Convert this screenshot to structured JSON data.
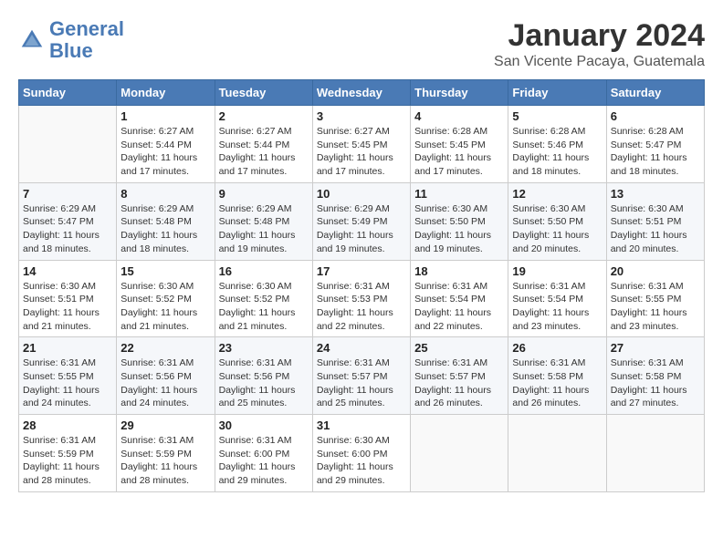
{
  "header": {
    "logo_line1": "General",
    "logo_line2": "Blue",
    "month_title": "January 2024",
    "subtitle": "San Vicente Pacaya, Guatemala"
  },
  "days_of_week": [
    "Sunday",
    "Monday",
    "Tuesday",
    "Wednesday",
    "Thursday",
    "Friday",
    "Saturday"
  ],
  "weeks": [
    [
      {
        "day": "",
        "info": ""
      },
      {
        "day": "1",
        "info": "Sunrise: 6:27 AM\nSunset: 5:44 PM\nDaylight: 11 hours and 17 minutes."
      },
      {
        "day": "2",
        "info": "Sunrise: 6:27 AM\nSunset: 5:44 PM\nDaylight: 11 hours and 17 minutes."
      },
      {
        "day": "3",
        "info": "Sunrise: 6:27 AM\nSunset: 5:45 PM\nDaylight: 11 hours and 17 minutes."
      },
      {
        "day": "4",
        "info": "Sunrise: 6:28 AM\nSunset: 5:45 PM\nDaylight: 11 hours and 17 minutes."
      },
      {
        "day": "5",
        "info": "Sunrise: 6:28 AM\nSunset: 5:46 PM\nDaylight: 11 hours and 18 minutes."
      },
      {
        "day": "6",
        "info": "Sunrise: 6:28 AM\nSunset: 5:47 PM\nDaylight: 11 hours and 18 minutes."
      }
    ],
    [
      {
        "day": "7",
        "info": "Sunrise: 6:29 AM\nSunset: 5:47 PM\nDaylight: 11 hours and 18 minutes."
      },
      {
        "day": "8",
        "info": "Sunrise: 6:29 AM\nSunset: 5:48 PM\nDaylight: 11 hours and 18 minutes."
      },
      {
        "day": "9",
        "info": "Sunrise: 6:29 AM\nSunset: 5:48 PM\nDaylight: 11 hours and 19 minutes."
      },
      {
        "day": "10",
        "info": "Sunrise: 6:29 AM\nSunset: 5:49 PM\nDaylight: 11 hours and 19 minutes."
      },
      {
        "day": "11",
        "info": "Sunrise: 6:30 AM\nSunset: 5:50 PM\nDaylight: 11 hours and 19 minutes."
      },
      {
        "day": "12",
        "info": "Sunrise: 6:30 AM\nSunset: 5:50 PM\nDaylight: 11 hours and 20 minutes."
      },
      {
        "day": "13",
        "info": "Sunrise: 6:30 AM\nSunset: 5:51 PM\nDaylight: 11 hours and 20 minutes."
      }
    ],
    [
      {
        "day": "14",
        "info": "Sunrise: 6:30 AM\nSunset: 5:51 PM\nDaylight: 11 hours and 21 minutes."
      },
      {
        "day": "15",
        "info": "Sunrise: 6:30 AM\nSunset: 5:52 PM\nDaylight: 11 hours and 21 minutes."
      },
      {
        "day": "16",
        "info": "Sunrise: 6:30 AM\nSunset: 5:52 PM\nDaylight: 11 hours and 21 minutes."
      },
      {
        "day": "17",
        "info": "Sunrise: 6:31 AM\nSunset: 5:53 PM\nDaylight: 11 hours and 22 minutes."
      },
      {
        "day": "18",
        "info": "Sunrise: 6:31 AM\nSunset: 5:54 PM\nDaylight: 11 hours and 22 minutes."
      },
      {
        "day": "19",
        "info": "Sunrise: 6:31 AM\nSunset: 5:54 PM\nDaylight: 11 hours and 23 minutes."
      },
      {
        "day": "20",
        "info": "Sunrise: 6:31 AM\nSunset: 5:55 PM\nDaylight: 11 hours and 23 minutes."
      }
    ],
    [
      {
        "day": "21",
        "info": "Sunrise: 6:31 AM\nSunset: 5:55 PM\nDaylight: 11 hours and 24 minutes."
      },
      {
        "day": "22",
        "info": "Sunrise: 6:31 AM\nSunset: 5:56 PM\nDaylight: 11 hours and 24 minutes."
      },
      {
        "day": "23",
        "info": "Sunrise: 6:31 AM\nSunset: 5:56 PM\nDaylight: 11 hours and 25 minutes."
      },
      {
        "day": "24",
        "info": "Sunrise: 6:31 AM\nSunset: 5:57 PM\nDaylight: 11 hours and 25 minutes."
      },
      {
        "day": "25",
        "info": "Sunrise: 6:31 AM\nSunset: 5:57 PM\nDaylight: 11 hours and 26 minutes."
      },
      {
        "day": "26",
        "info": "Sunrise: 6:31 AM\nSunset: 5:58 PM\nDaylight: 11 hours and 26 minutes."
      },
      {
        "day": "27",
        "info": "Sunrise: 6:31 AM\nSunset: 5:58 PM\nDaylight: 11 hours and 27 minutes."
      }
    ],
    [
      {
        "day": "28",
        "info": "Sunrise: 6:31 AM\nSunset: 5:59 PM\nDaylight: 11 hours and 28 minutes."
      },
      {
        "day": "29",
        "info": "Sunrise: 6:31 AM\nSunset: 5:59 PM\nDaylight: 11 hours and 28 minutes."
      },
      {
        "day": "30",
        "info": "Sunrise: 6:31 AM\nSunset: 6:00 PM\nDaylight: 11 hours and 29 minutes."
      },
      {
        "day": "31",
        "info": "Sunrise: 6:30 AM\nSunset: 6:00 PM\nDaylight: 11 hours and 29 minutes."
      },
      {
        "day": "",
        "info": ""
      },
      {
        "day": "",
        "info": ""
      },
      {
        "day": "",
        "info": ""
      }
    ]
  ]
}
